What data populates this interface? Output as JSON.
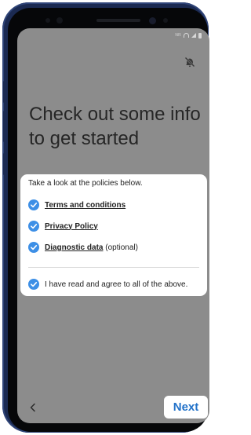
{
  "status_bar": {
    "network": "NR",
    "icons": [
      "wifi-icon",
      "signal-icon",
      "battery-icon"
    ]
  },
  "mute_icon": "mute-icon",
  "heading": "Check out some info to get started",
  "policies": {
    "intro": "Take a look at the policies below.",
    "items": [
      {
        "label": "Terms and conditions",
        "suffix": "",
        "checked": true
      },
      {
        "label": "Privacy Policy",
        "suffix": "",
        "checked": true
      },
      {
        "label": "Diagnostic data",
        "suffix": "(optional)",
        "checked": true
      }
    ],
    "agree_all": {
      "label": "I have read and agree to all of the above.",
      "checked": true
    }
  },
  "footer": {
    "back_icon": "chevron-left-icon",
    "next_label": "Next"
  },
  "colors": {
    "screen_bg": "#8c8c8c",
    "check_blue": "#3d8fe6",
    "next_text": "#2272c9",
    "phone_frame": "#1b2a52"
  }
}
